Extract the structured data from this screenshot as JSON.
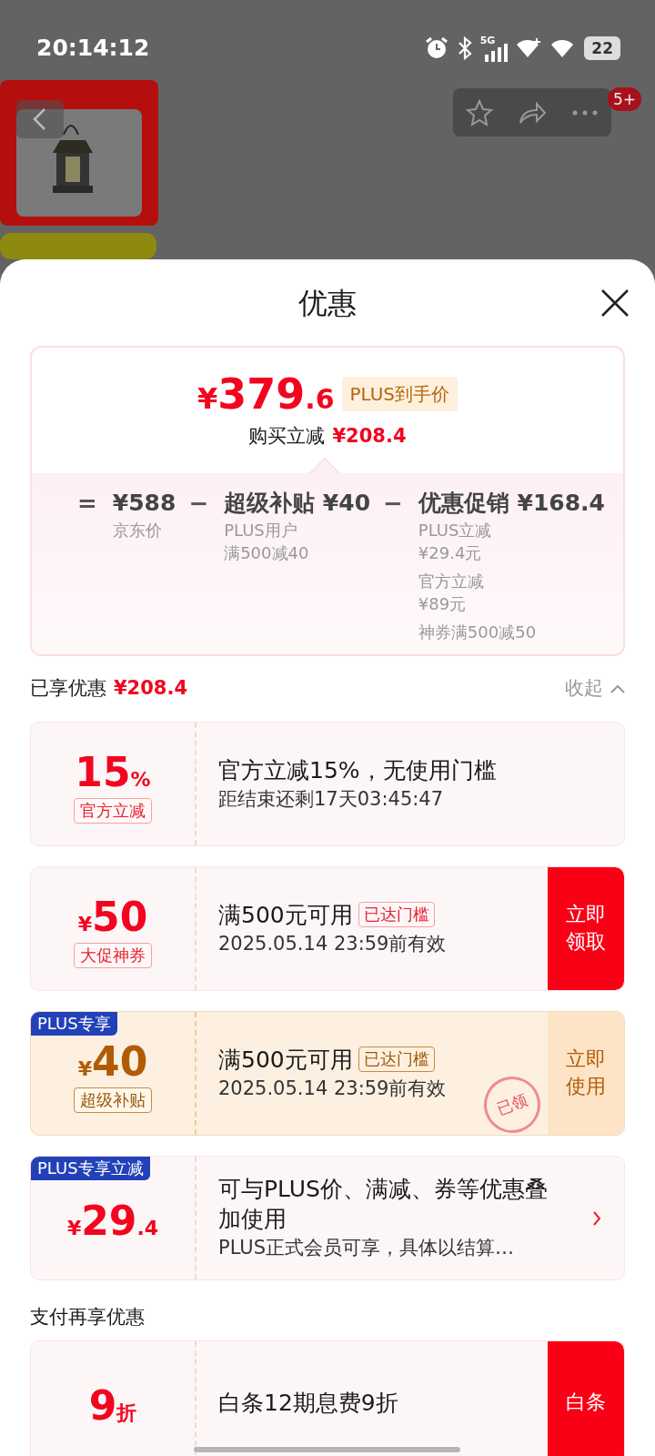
{
  "status_bar": {
    "time": "20:14:12",
    "battery": "22",
    "network": "5G"
  },
  "background_page": {
    "cart_badge": "5+"
  },
  "sheet": {
    "title": "优惠"
  },
  "summary": {
    "price": {
      "currency": "¥",
      "integer": "379",
      "decimal": ".6"
    },
    "price_tag": "PLUS到手价",
    "savings_label": "购买立减",
    "savings_value": "¥208.4",
    "breakdown": [
      {
        "operator": "=",
        "amount": "¥588",
        "notes": [
          [
            "京东价"
          ]
        ]
      },
      {
        "operator": "−",
        "amount": "超级补贴 ¥40",
        "notes": [
          [
            "PLUS用户",
            "满500减40"
          ]
        ]
      },
      {
        "operator": "−",
        "amount": "优惠促销 ¥168.4",
        "notes": [
          [
            "PLUS立减",
            "¥29.4元"
          ],
          [
            "官方立减",
            "¥89元"
          ],
          [
            "神券满500减50"
          ]
        ]
      }
    ]
  },
  "applied": {
    "label": "已享优惠",
    "amount": "¥208.4",
    "toggle": "收起",
    "expanded": true
  },
  "coupons": [
    {
      "kind": "standard",
      "value": "15",
      "unit": "%",
      "type_label": "官方立减",
      "title": "官方立减15%，无使用门槛",
      "subtitle": "距结束还剩17天03:45:47"
    },
    {
      "kind": "standard",
      "currency": "¥",
      "value": "50",
      "type_label": "大促神券",
      "title": "满500元可用",
      "status": "已达门槛",
      "subtitle": "2025.05.14 23:59前有效",
      "action": "立即领取"
    },
    {
      "kind": "plus",
      "tag": "PLUS专享",
      "currency": "¥",
      "value": "40",
      "type_label": "超级补贴",
      "title": "满500元可用",
      "status": "已达门槛",
      "subtitle": "2025.05.14 23:59前有效",
      "action": "立即使用",
      "stamp": "已领"
    },
    {
      "kind": "standard",
      "tag": "PLUS专享立减",
      "currency": "¥",
      "value": "29",
      "decimal": ".4",
      "title": "可与PLUS价、满减、券等优惠叠加使用",
      "subtitle": "PLUS正式会员可享，具体以结算…",
      "link": true
    }
  ],
  "payment": {
    "heading": "支付再享优惠",
    "coupons": [
      {
        "kind": "standard",
        "value": "9",
        "unit": "折",
        "title": "白条12期息费9折",
        "action": "白条"
      }
    ]
  }
}
